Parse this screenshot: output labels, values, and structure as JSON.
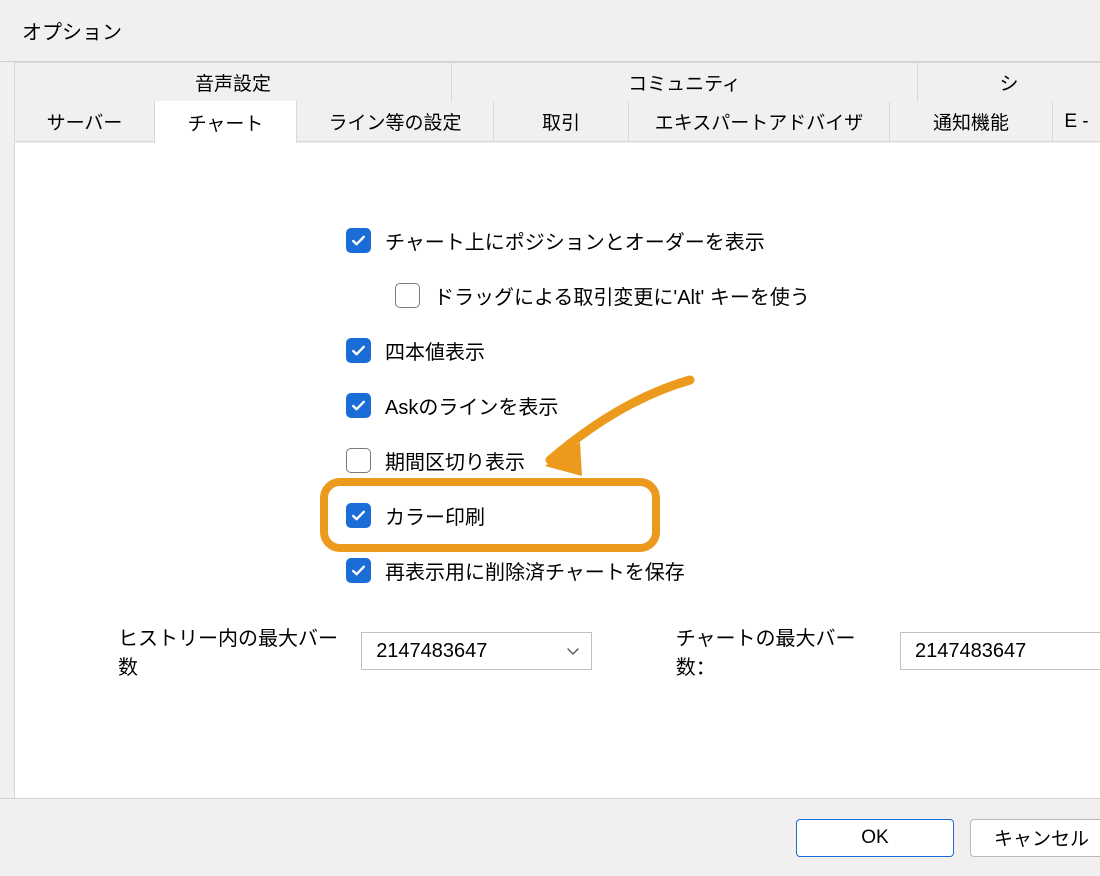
{
  "window": {
    "title": "オプション"
  },
  "tabs": {
    "top": {
      "audio": "音声設定",
      "community": "コミュニティ",
      "signal": "シ"
    },
    "bottom": {
      "server": "サーバー",
      "chart": "チャート",
      "line": "ライン等の設定",
      "trade": "取引",
      "ea": "エキスパートアドバイザ",
      "notif": "通知機能",
      "email": "E -"
    },
    "active": "chart"
  },
  "options": {
    "show_positions": {
      "checked": true,
      "label": "チャート上にポジションとオーダーを表示"
    },
    "alt_drag": {
      "checked": false,
      "label": "ドラッグによる取引変更に'Alt' キーを使う"
    },
    "four_values": {
      "checked": true,
      "label": "四本値表示"
    },
    "show_ask": {
      "checked": true,
      "label": "Askのラインを表示"
    },
    "period_separator": {
      "checked": false,
      "label": "期間区切り表示"
    },
    "color_print": {
      "checked": true,
      "label": "カラー印刷"
    },
    "save_deleted_charts": {
      "checked": true,
      "label": "再表示用に削除済チャートを保存"
    }
  },
  "bars": {
    "history_label": "ヒストリー内の最大バー数",
    "history_value": "2147483647",
    "chart_label": "チャートの最大バー数：",
    "chart_value": "2147483647"
  },
  "buttons": {
    "ok": "OK",
    "cancel": "キャンセル"
  },
  "colors": {
    "accent": "#1a6dd6",
    "highlight": "#eb9a1e"
  }
}
